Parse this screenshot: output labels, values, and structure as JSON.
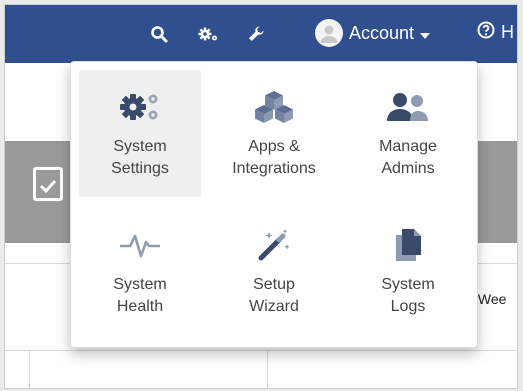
{
  "header": {
    "account_label": "Account",
    "help_label": "H",
    "icons": [
      "search-icon",
      "cogs-icon",
      "wrench-icon",
      "user-avatar-icon",
      "caret-down-icon",
      "help-circle-icon"
    ]
  },
  "menu": {
    "items": [
      {
        "label": "System\nSettings",
        "icon": "cogs-icon",
        "active": true
      },
      {
        "label": "Apps &\nIntegrations",
        "icon": "cubes-icon",
        "active": false
      },
      {
        "label": "Manage\nAdmins",
        "icon": "users-icon",
        "active": false
      },
      {
        "label": "System\nHealth",
        "icon": "heartbeat-icon",
        "active": false
      },
      {
        "label": "Setup\nWizard",
        "icon": "magic-wand-icon",
        "active": false
      },
      {
        "label": "System\nLogs",
        "icon": "files-icon",
        "active": false
      }
    ]
  },
  "background": {
    "partial_text": "s Wee"
  },
  "colors": {
    "topbar": "#2f4f8f",
    "icon": "#3a4a6a",
    "accent_icon": "#4e6b9a",
    "active_tile": "#efefef"
  }
}
